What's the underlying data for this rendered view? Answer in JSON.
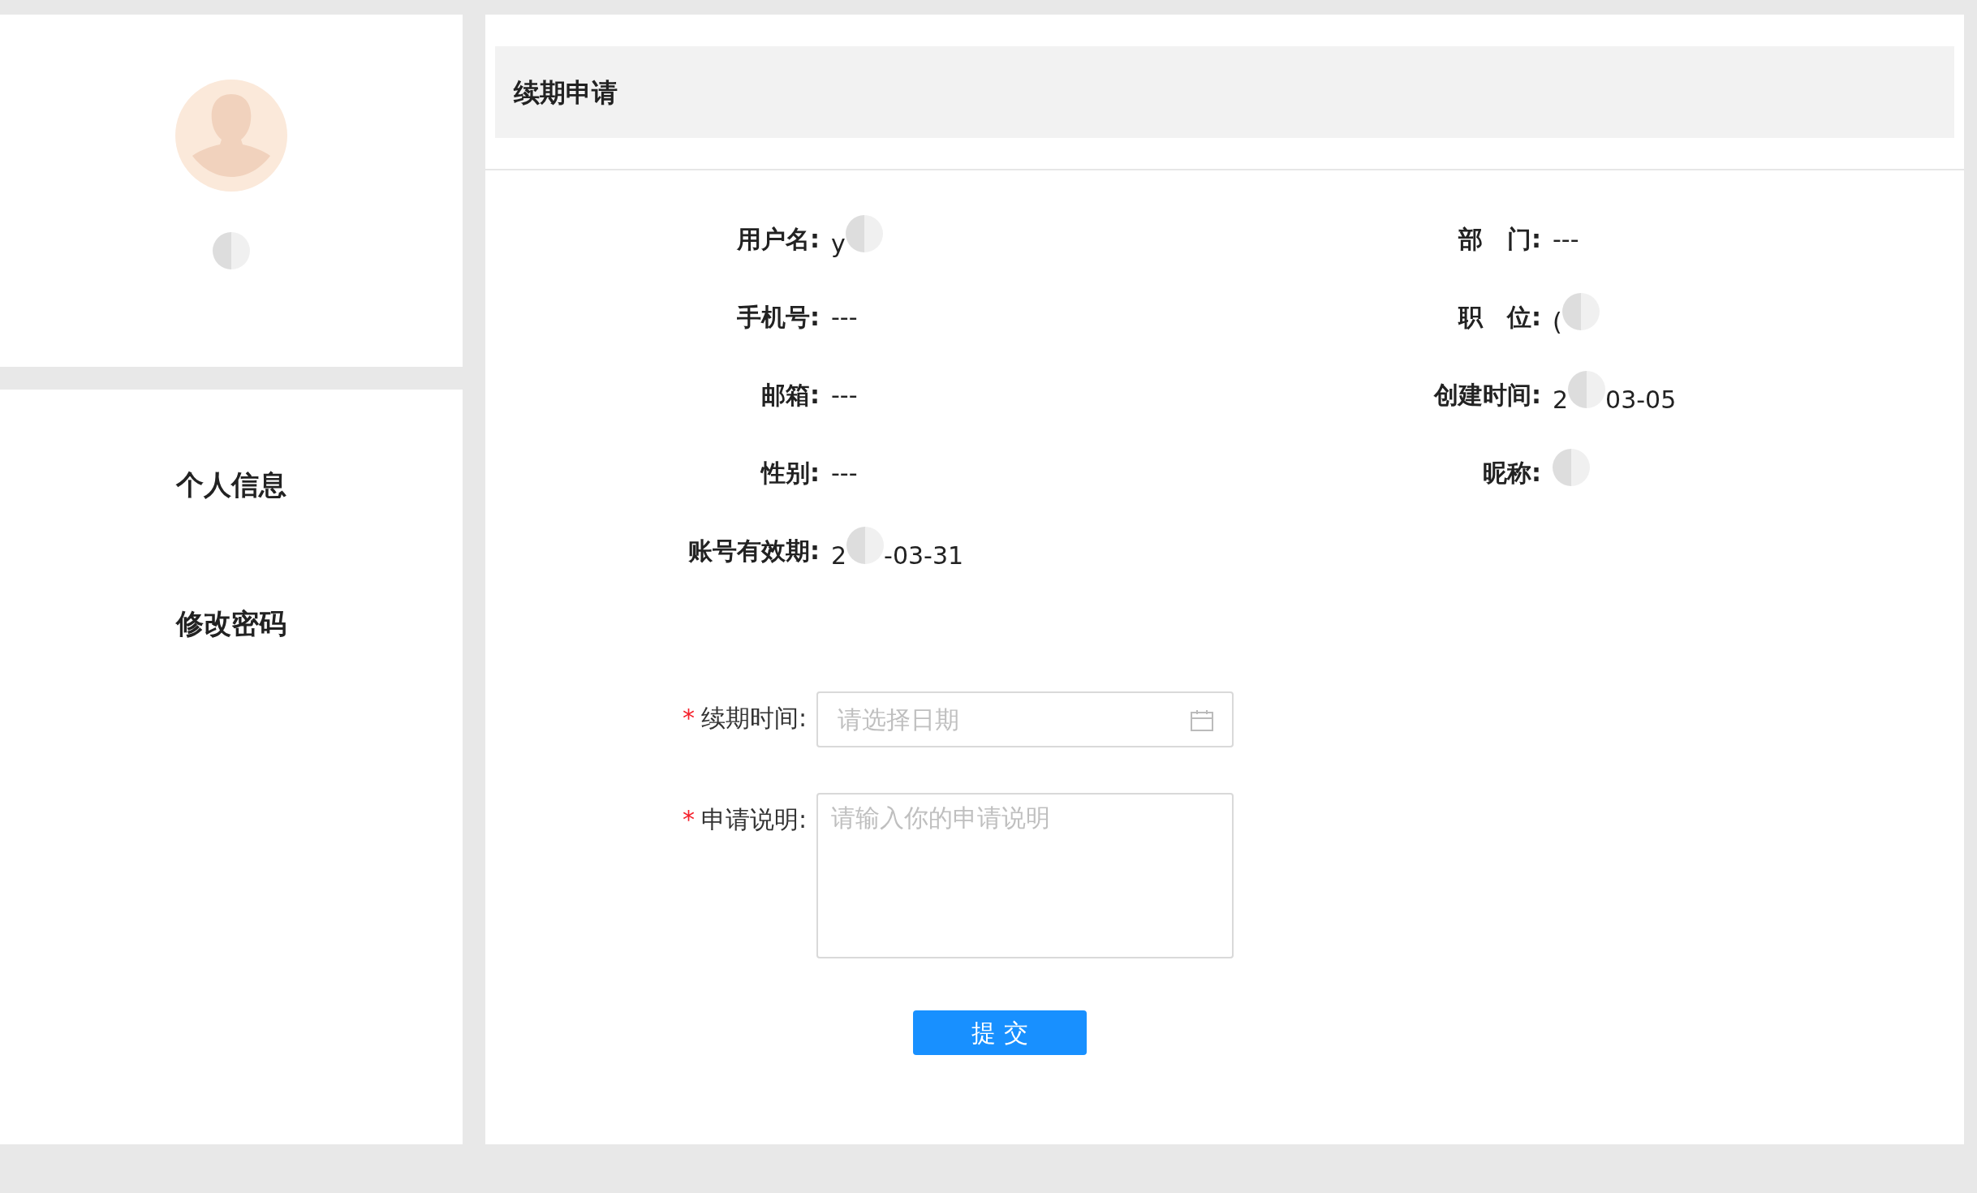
{
  "user_card": {
    "avatar": {
      "kind": "avatar"
    },
    "name": {
      "redacted": true
    }
  },
  "menu": [
    {
      "label": "个人信息"
    },
    {
      "label": "修改密码"
    }
  ],
  "panel": {
    "title": "续期申请"
  },
  "info_rows": [
    {
      "left": {
        "label": "用户名:",
        "value": "y",
        "redacted": true
      },
      "right": {
        "label": "部　门:",
        "value": "---"
      }
    },
    {
      "left": {
        "label": "手机号:",
        "value": "---"
      },
      "right": {
        "label": "职　位:",
        "value": "(",
        "redacted": true
      }
    },
    {
      "left": {
        "label": "邮箱:",
        "value": "---"
      },
      "right": {
        "label": "创建时间:",
        "value": "2",
        "redacted": true,
        "value_after": "03-05"
      }
    },
    {
      "left": {
        "label": "性别:",
        "value": "---"
      },
      "right": {
        "label": "昵称:",
        "redacted": true
      }
    },
    {
      "left": {
        "label": "账号有效期:",
        "value": "2",
        "redacted": true,
        "value_after": "-03-31"
      }
    }
  ],
  "form": [
    {
      "kind": "date",
      "label": "续期时间:",
      "required": true,
      "required_mark": "*",
      "placeholder": "请选择日期"
    },
    {
      "kind": "textarea",
      "label": "申请说明:",
      "required": true,
      "required_mark": "*",
      "placeholder": "请输入你的申请说明"
    }
  ],
  "submit": "提 交"
}
